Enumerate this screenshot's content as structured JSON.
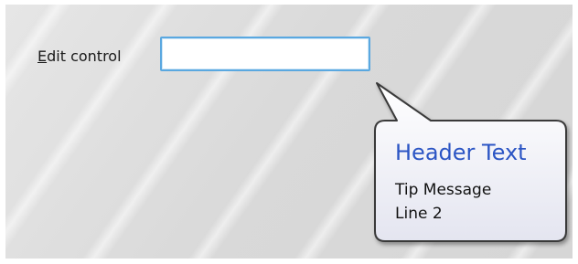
{
  "form": {
    "edit_label_mnemonic": "E",
    "edit_label_rest": "dit control",
    "edit_value": ""
  },
  "balloon_tip": {
    "title": "Header Text",
    "message_line1": "Tip Message",
    "message_line2": "Line 2"
  },
  "colors": {
    "tip_title": "#2b55c4",
    "edit_border": "#5aa8e0"
  }
}
